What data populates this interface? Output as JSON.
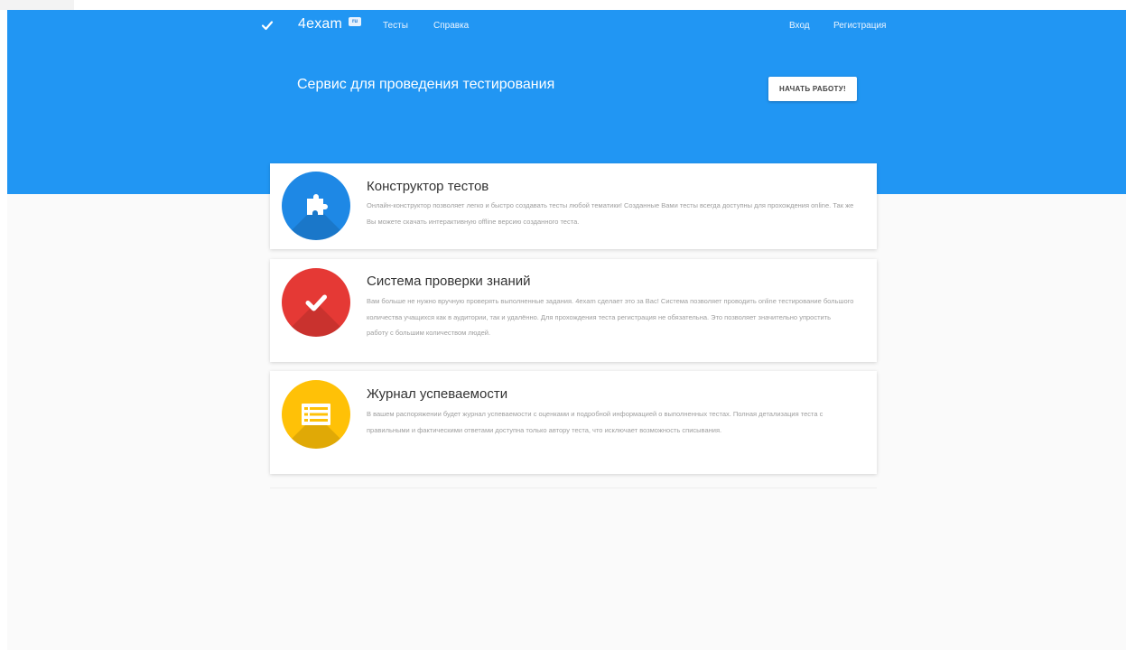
{
  "header": {
    "logo_icon": "check-icon",
    "brand": "4exam",
    "brand_badge": "ru",
    "nav_links": [
      "Тесты",
      "Справка"
    ],
    "auth_links": [
      "Вход",
      "Регистрация"
    ]
  },
  "hero": {
    "title": "Сервис для проведения тестирования",
    "cta_label": "НАЧАТЬ РАБОТУ!",
    "background_color": "#2196f3"
  },
  "features": [
    {
      "icon": "puzzle-icon",
      "color": "#1e88e5",
      "title": "Конструктор тестов",
      "description": "Онлайн-конструктор позволяет легко и быстро создавать тесты любой тематики! Созданные Вами тесты всегда доступны для прохождения online. Так же Вы можете скачать интерактивную offline версию созданного теста."
    },
    {
      "icon": "checkmark-icon",
      "color": "#e53935",
      "title": "Система проверки знаний",
      "description": "Вам больше не нужно вручную проверять выполненные задания. 4exam сделает это за Вас! Система позволяет проводить online тестирование большого количества учащихся как в аудитории, так и удалённо. Для прохождения теста регистрация не обязательна. Это позволяет значительно упростить работу с большим количеством людей."
    },
    {
      "icon": "list-icon",
      "color": "#ffc107",
      "title": "Журнал успеваемости",
      "description": "В вашем распоряжении будет журнал успеваемости с оценками и подробной информацией о выполненных тестах. Полная детализация теста с правильными и фактическими ответами доступна только автору теста, что исключает возможность списывания."
    }
  ]
}
